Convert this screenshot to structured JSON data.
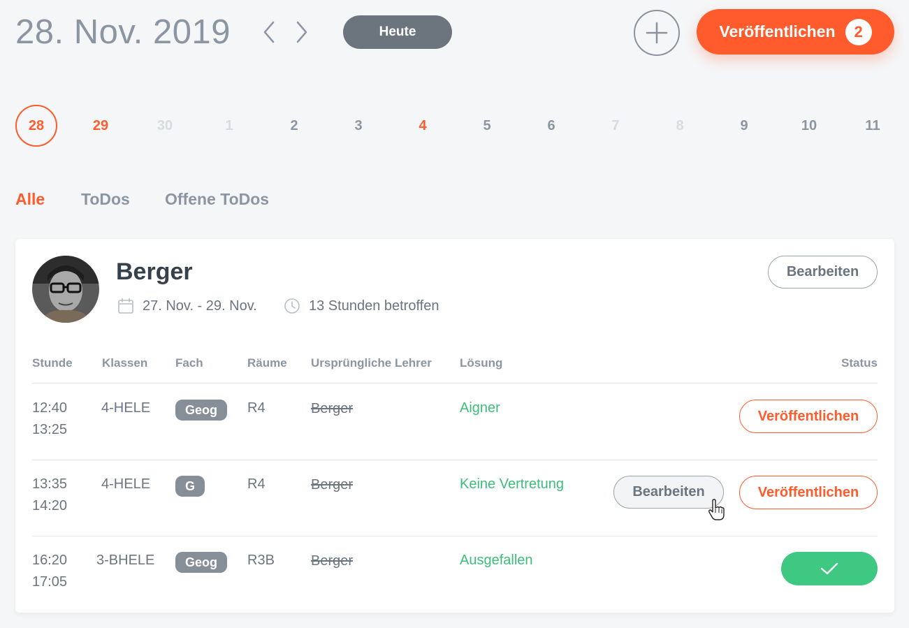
{
  "header": {
    "date_title": "28. Nov. 2019",
    "today_label": "Heute",
    "publish_label": "Veröffentlichen",
    "publish_count": "2"
  },
  "days": [
    {
      "label": "28",
      "state": "selected"
    },
    {
      "label": "29",
      "state": "highlight"
    },
    {
      "label": "30",
      "state": "disabled"
    },
    {
      "label": "1",
      "state": "disabled"
    },
    {
      "label": "2",
      "state": "normal"
    },
    {
      "label": "3",
      "state": "normal"
    },
    {
      "label": "4",
      "state": "highlight"
    },
    {
      "label": "5",
      "state": "normal"
    },
    {
      "label": "6",
      "state": "normal"
    },
    {
      "label": "7",
      "state": "disabled"
    },
    {
      "label": "8",
      "state": "disabled"
    },
    {
      "label": "9",
      "state": "normal"
    },
    {
      "label": "10",
      "state": "normal"
    },
    {
      "label": "11",
      "state": "normal"
    }
  ],
  "tabs": [
    {
      "label": "Alle",
      "active": true
    },
    {
      "label": "ToDos",
      "active": false
    },
    {
      "label": "Offene ToDos",
      "active": false
    }
  ],
  "card": {
    "teacher_name": "Berger",
    "date_range": "27. Nov. - 29. Nov.",
    "hours_affected": "13 Stunden betroffen",
    "edit_label": "Bearbeiten",
    "columns": {
      "stunde": "Stunde",
      "klassen": "Klassen",
      "fach": "Fach",
      "raeume": "Räume",
      "lehrer": "Ursprüngliche Lehrer",
      "loesung": "Lösung",
      "status": "Status"
    },
    "rows": [
      {
        "start": "12:40",
        "end": "13:25",
        "klasse": "4-HELE",
        "fach": "Geog",
        "raum": "R4",
        "lehrer": "Berger",
        "loesung": "Aigner",
        "edit_label": "",
        "publish_label": "Veröffentlichen",
        "done": false
      },
      {
        "start": "13:35",
        "end": "14:20",
        "klasse": "4-HELE",
        "fach": "G",
        "raum": "R4",
        "lehrer": "Berger",
        "loesung": "Keine Vertretung",
        "edit_label": "Bearbeiten",
        "publish_label": "Veröffentlichen",
        "done": false
      },
      {
        "start": "16:20",
        "end": "17:05",
        "klasse": "3-BHELE",
        "fach": "Geog",
        "raum": "R3B",
        "lehrer": "Berger",
        "loesung": "Ausgefallen",
        "edit_label": "",
        "publish_label": "",
        "done": true
      }
    ]
  },
  "colors": {
    "accent": "#ff5b2c",
    "success": "#3ec882",
    "muted": "#8b96a2"
  },
  "icons": {
    "prev": "chevron-left-icon",
    "next": "chevron-right-icon",
    "add": "plus-icon",
    "calendar": "calendar-icon",
    "clock": "clock-icon",
    "check": "check-icon",
    "cursor": "hand-pointer-icon"
  }
}
